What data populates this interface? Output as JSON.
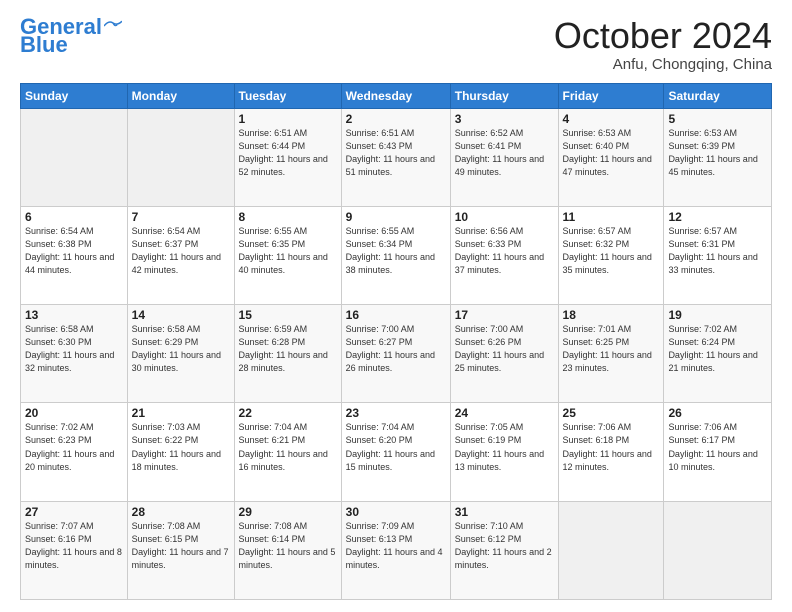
{
  "header": {
    "logo_line1": "General",
    "logo_line2": "Blue",
    "month": "October 2024",
    "location": "Anfu, Chongqing, China"
  },
  "weekdays": [
    "Sunday",
    "Monday",
    "Tuesday",
    "Wednesday",
    "Thursday",
    "Friday",
    "Saturday"
  ],
  "weeks": [
    [
      {
        "day": "",
        "info": ""
      },
      {
        "day": "",
        "info": ""
      },
      {
        "day": "1",
        "info": "Sunrise: 6:51 AM\nSunset: 6:44 PM\nDaylight: 11 hours and 52 minutes."
      },
      {
        "day": "2",
        "info": "Sunrise: 6:51 AM\nSunset: 6:43 PM\nDaylight: 11 hours and 51 minutes."
      },
      {
        "day": "3",
        "info": "Sunrise: 6:52 AM\nSunset: 6:41 PM\nDaylight: 11 hours and 49 minutes."
      },
      {
        "day": "4",
        "info": "Sunrise: 6:53 AM\nSunset: 6:40 PM\nDaylight: 11 hours and 47 minutes."
      },
      {
        "day": "5",
        "info": "Sunrise: 6:53 AM\nSunset: 6:39 PM\nDaylight: 11 hours and 45 minutes."
      }
    ],
    [
      {
        "day": "6",
        "info": "Sunrise: 6:54 AM\nSunset: 6:38 PM\nDaylight: 11 hours and 44 minutes."
      },
      {
        "day": "7",
        "info": "Sunrise: 6:54 AM\nSunset: 6:37 PM\nDaylight: 11 hours and 42 minutes."
      },
      {
        "day": "8",
        "info": "Sunrise: 6:55 AM\nSunset: 6:35 PM\nDaylight: 11 hours and 40 minutes."
      },
      {
        "day": "9",
        "info": "Sunrise: 6:55 AM\nSunset: 6:34 PM\nDaylight: 11 hours and 38 minutes."
      },
      {
        "day": "10",
        "info": "Sunrise: 6:56 AM\nSunset: 6:33 PM\nDaylight: 11 hours and 37 minutes."
      },
      {
        "day": "11",
        "info": "Sunrise: 6:57 AM\nSunset: 6:32 PM\nDaylight: 11 hours and 35 minutes."
      },
      {
        "day": "12",
        "info": "Sunrise: 6:57 AM\nSunset: 6:31 PM\nDaylight: 11 hours and 33 minutes."
      }
    ],
    [
      {
        "day": "13",
        "info": "Sunrise: 6:58 AM\nSunset: 6:30 PM\nDaylight: 11 hours and 32 minutes."
      },
      {
        "day": "14",
        "info": "Sunrise: 6:58 AM\nSunset: 6:29 PM\nDaylight: 11 hours and 30 minutes."
      },
      {
        "day": "15",
        "info": "Sunrise: 6:59 AM\nSunset: 6:28 PM\nDaylight: 11 hours and 28 minutes."
      },
      {
        "day": "16",
        "info": "Sunrise: 7:00 AM\nSunset: 6:27 PM\nDaylight: 11 hours and 26 minutes."
      },
      {
        "day": "17",
        "info": "Sunrise: 7:00 AM\nSunset: 6:26 PM\nDaylight: 11 hours and 25 minutes."
      },
      {
        "day": "18",
        "info": "Sunrise: 7:01 AM\nSunset: 6:25 PM\nDaylight: 11 hours and 23 minutes."
      },
      {
        "day": "19",
        "info": "Sunrise: 7:02 AM\nSunset: 6:24 PM\nDaylight: 11 hours and 21 minutes."
      }
    ],
    [
      {
        "day": "20",
        "info": "Sunrise: 7:02 AM\nSunset: 6:23 PM\nDaylight: 11 hours and 20 minutes."
      },
      {
        "day": "21",
        "info": "Sunrise: 7:03 AM\nSunset: 6:22 PM\nDaylight: 11 hours and 18 minutes."
      },
      {
        "day": "22",
        "info": "Sunrise: 7:04 AM\nSunset: 6:21 PM\nDaylight: 11 hours and 16 minutes."
      },
      {
        "day": "23",
        "info": "Sunrise: 7:04 AM\nSunset: 6:20 PM\nDaylight: 11 hours and 15 minutes."
      },
      {
        "day": "24",
        "info": "Sunrise: 7:05 AM\nSunset: 6:19 PM\nDaylight: 11 hours and 13 minutes."
      },
      {
        "day": "25",
        "info": "Sunrise: 7:06 AM\nSunset: 6:18 PM\nDaylight: 11 hours and 12 minutes."
      },
      {
        "day": "26",
        "info": "Sunrise: 7:06 AM\nSunset: 6:17 PM\nDaylight: 11 hours and 10 minutes."
      }
    ],
    [
      {
        "day": "27",
        "info": "Sunrise: 7:07 AM\nSunset: 6:16 PM\nDaylight: 11 hours and 8 minutes."
      },
      {
        "day": "28",
        "info": "Sunrise: 7:08 AM\nSunset: 6:15 PM\nDaylight: 11 hours and 7 minutes."
      },
      {
        "day": "29",
        "info": "Sunrise: 7:08 AM\nSunset: 6:14 PM\nDaylight: 11 hours and 5 minutes."
      },
      {
        "day": "30",
        "info": "Sunrise: 7:09 AM\nSunset: 6:13 PM\nDaylight: 11 hours and 4 minutes."
      },
      {
        "day": "31",
        "info": "Sunrise: 7:10 AM\nSunset: 6:12 PM\nDaylight: 11 hours and 2 minutes."
      },
      {
        "day": "",
        "info": ""
      },
      {
        "day": "",
        "info": ""
      }
    ]
  ]
}
